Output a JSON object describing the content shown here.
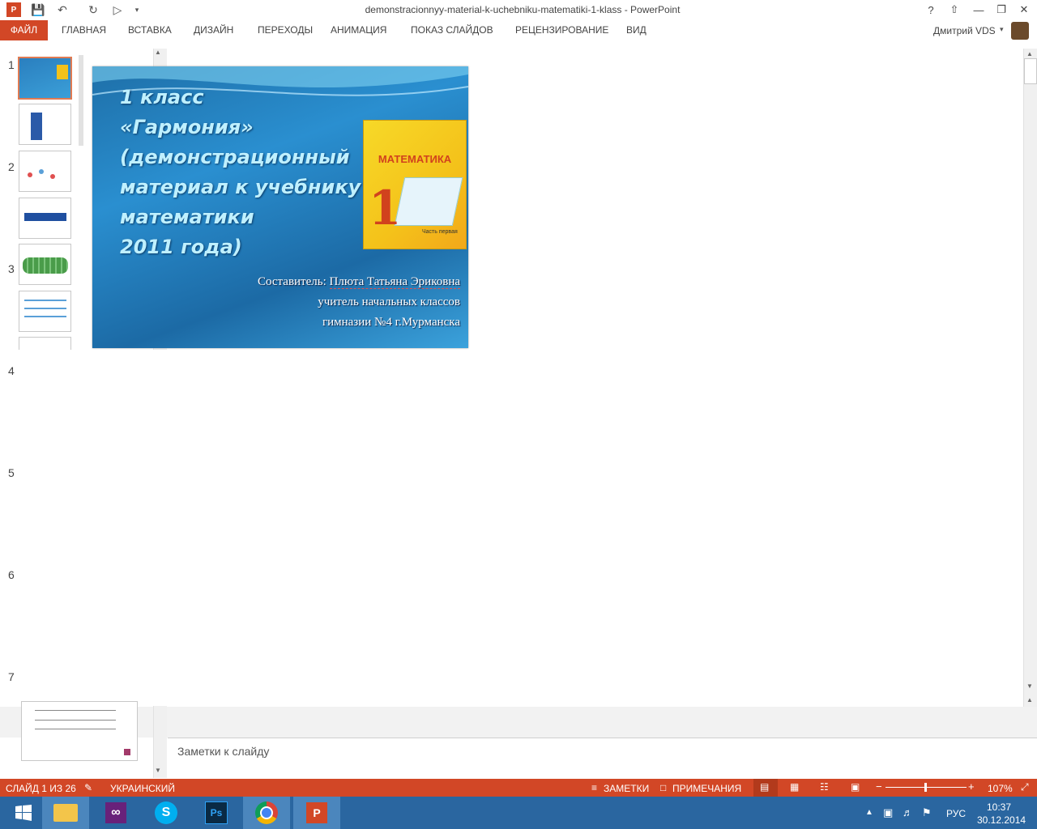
{
  "window": {
    "title": "demonstracionnyy-material-k-uchebniku-matematiki-1-klass - PowerPoint"
  },
  "ribbon": {
    "tabs": [
      "ФАЙЛ",
      "ГЛАВНАЯ",
      "ВСТАВКА",
      "ДИЗАЙН",
      "ПЕРЕХОДЫ",
      "АНИМАЦИЯ",
      "ПОКАЗ СЛАЙДОВ",
      "РЕЦЕНЗИРОВАНИЕ",
      "ВИД"
    ],
    "user": "Дмитрий VDS"
  },
  "thumbnails": {
    "numbers": [
      "1",
      "2",
      "3",
      "4",
      "5",
      "6",
      "7"
    ]
  },
  "slide": {
    "title_lines": [
      "1 класс",
      "«Гармония»",
      "(демонстрационный",
      "материал к учебнику",
      "математики",
      "2011 года)"
    ],
    "author_prefix": "Составитель: ",
    "author_name": "Плюта Татьяна Эриковна",
    "author_line2": "учитель начальных классов",
    "author_line3": "гимназии №4 г.Мурманска",
    "book": {
      "title": "МАТЕМАТИКА",
      "number": "1",
      "part": "Часть первая"
    }
  },
  "notes": {
    "placeholder": "Заметки к слайду"
  },
  "status": {
    "slide_counter": "СЛАЙД 1 ИЗ 26",
    "language": "УКРАИНСКИЙ",
    "notes_btn": "ЗАМЕТКИ",
    "comments_btn": "ПРИМЕЧАНИЯ",
    "zoom": "107%"
  },
  "taskbar": {
    "lang": "РУС",
    "time": "10:37",
    "date": "30.12.2014"
  },
  "colors": {
    "accent": "#d24726",
    "taskbar": "#2a66a0"
  }
}
